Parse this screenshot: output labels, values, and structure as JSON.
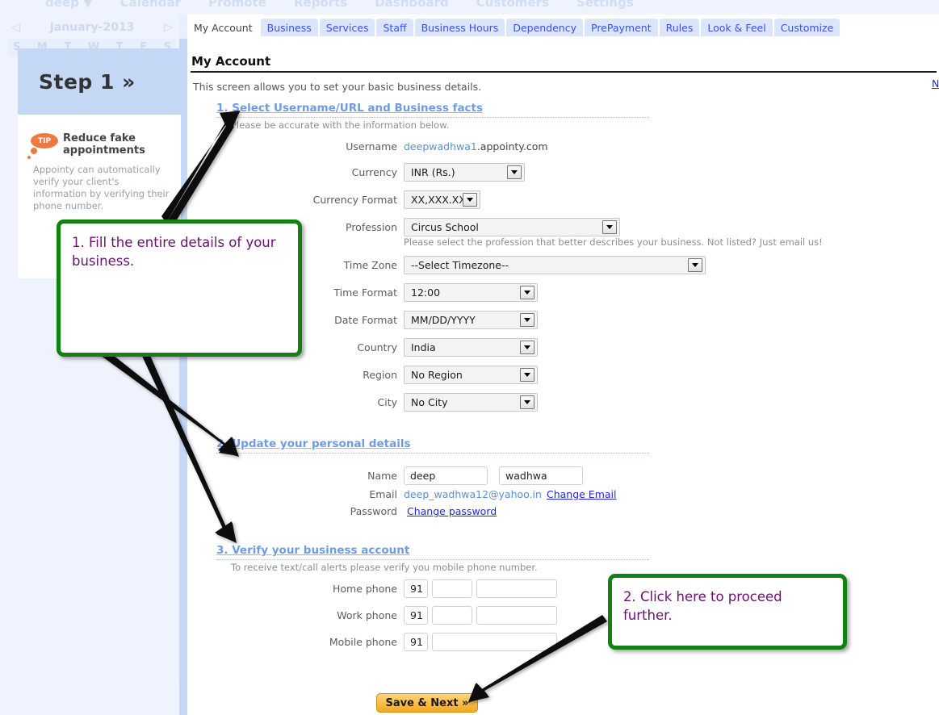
{
  "topnav": {
    "items": [
      "deep ▼",
      "Calendar",
      "Promote",
      "Reports",
      "Dashboard",
      "Customers",
      "Settings"
    ]
  },
  "sidebar": {
    "calendar": {
      "prev_icon": "◁",
      "month_label": "January-2013",
      "next_icon": "▷",
      "day_headers": [
        "S",
        "M",
        "T",
        "W",
        "T",
        "F",
        "S"
      ]
    },
    "step": {
      "label": "Step 1 »"
    },
    "tip": {
      "badge": "TIP",
      "title": "Reduce fake appointments",
      "body": "Appointy can automatically verify your client's information by verifying their phone number."
    }
  },
  "tabs": [
    {
      "label": "My Account",
      "active": true
    },
    {
      "label": "Business",
      "active": false
    },
    {
      "label": "Services",
      "active": false
    },
    {
      "label": "Staff",
      "active": false
    },
    {
      "label": "Business Hours",
      "active": false
    },
    {
      "label": "Dependency",
      "active": false
    },
    {
      "label": "PrePayment",
      "active": false
    },
    {
      "label": "Rules",
      "active": false
    },
    {
      "label": "Look & Feel",
      "active": false
    },
    {
      "label": "Customize",
      "active": false
    }
  ],
  "page": {
    "title": "My Account",
    "subtitle": "This screen allows you to set your basic business details.",
    "corner_link": "N"
  },
  "section1": {
    "title": "1. Select Username/URL and Business facts",
    "description": "Please be accurate with the information below.",
    "username": {
      "label": "Username",
      "value_highlight": "deepwadhwa1",
      "value_rest": ".appointy.com"
    },
    "currency": {
      "label": "Currency",
      "value": "INR (Rs.)"
    },
    "currency_format": {
      "label": "Currency Format",
      "value": "XX,XXX.XX"
    },
    "profession": {
      "label": "Profession",
      "value": "Circus School",
      "hint": "Please select the profession that better describes your business. Not listed? Just email us!"
    },
    "timezone": {
      "label": "Time Zone",
      "value": "--Select Timezone--"
    },
    "time_format": {
      "label": "Time Format",
      "value": "12:00"
    },
    "date_format": {
      "label": "Date Format",
      "value": "MM/DD/YYYY"
    },
    "country": {
      "label": "Country",
      "value": "India"
    },
    "region": {
      "label": "Region",
      "value": "No Region"
    },
    "city": {
      "label": "City",
      "value": "No City"
    }
  },
  "section2": {
    "title": "2. Update your personal details",
    "name": {
      "label": "Name",
      "first": "deep",
      "last": "wadhwa"
    },
    "email": {
      "label": "Email",
      "value": "deep_wadhwa12@yahoo.in",
      "change_link": "Change Email"
    },
    "password": {
      "label": "Password",
      "change_link": "Change password"
    }
  },
  "section3": {
    "title": "3. Verify your business account",
    "description": "To receive text/call alerts please verify you mobile phone number.",
    "home_phone": {
      "label": "Home phone",
      "code": "91",
      "area": "",
      "number": ""
    },
    "work_phone": {
      "label": "Work phone",
      "code": "91",
      "area": "",
      "number": ""
    },
    "mobile_phone": {
      "label": "Mobile phone",
      "code": "91",
      "number": ""
    }
  },
  "actions": {
    "save_next": "Save & Next »"
  },
  "annotations": [
    {
      "id": 1,
      "text": "1. Fill the entire details of your business."
    },
    {
      "id": 2,
      "text": "2. Click here to proceed further."
    }
  ],
  "colors": {
    "annotation_border": "#128012",
    "annotation_text": "#6a1070",
    "section_header": "#6f9be0",
    "tab_active_bg": "#ffffff",
    "tab_inactive_bg": "#dbe5fb",
    "tab_text": "#3c4ff0",
    "button_gradient_top": "#ffd579",
    "button_gradient_bottom": "#f3a81f",
    "tip_badge": "#f0793f",
    "sidebar_bg": "#eef3fd",
    "step_header_bg": "#c4d8f5"
  }
}
